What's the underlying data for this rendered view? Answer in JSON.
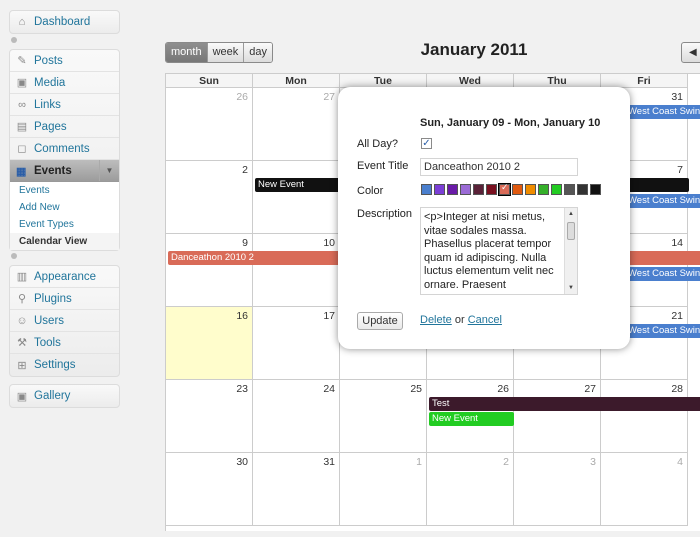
{
  "sidebar": {
    "dashboard": "Dashboard",
    "posts": "Posts",
    "media": "Media",
    "links": "Links",
    "pages": "Pages",
    "comments": "Comments",
    "events": "Events",
    "events_submenu": [
      "Events",
      "Add New",
      "Event Types",
      "Calendar View"
    ],
    "appearance": "Appearance",
    "plugins": "Plugins",
    "users": "Users",
    "tools": "Tools",
    "settings": "Settings",
    "gallery": "Gallery"
  },
  "toolbar": {
    "month": "month",
    "week": "week",
    "day": "day",
    "active": "month",
    "prev_arrow": "◀"
  },
  "calendar": {
    "title": "January 2011",
    "days_of_week": [
      "Sun",
      "Mon",
      "Tue",
      "Wed",
      "Thu",
      "Fri"
    ],
    "weeks": [
      [
        "26",
        "27",
        "",
        "",
        "",
        "31"
      ],
      [
        "2",
        "",
        "",
        "",
        "",
        "7"
      ],
      [
        "9",
        "10",
        "",
        "",
        "",
        "14"
      ],
      [
        "16",
        "17",
        "",
        "",
        "",
        "21"
      ],
      [
        "23",
        "24",
        "25",
        "26",
        "27",
        "28"
      ],
      [
        "30",
        "31",
        "1",
        "2",
        "3",
        "4"
      ]
    ],
    "events": {
      "new_event_1": "New Event",
      "danceathon": "Danceathon 2010 2",
      "west_coast_1": "West Coast Swin",
      "west_coast_2": "West Coast Swin",
      "west_coast_3": "West Coast Swin",
      "west_coast_4": "West Coast Swin",
      "test": "Test",
      "new_event_2": "New Event"
    },
    "colors": {
      "new_event_1": "#111111",
      "danceathon": "#d96b58",
      "west_coast": "#4a7fce",
      "test": "#3c1a2b",
      "new_event_2": "#22cc22",
      "today": "#fffdcc"
    }
  },
  "popup": {
    "date_range": "Sun, January 09 - Mon, January 10",
    "all_day_label": "All Day?",
    "all_day_checked": true,
    "event_title_label": "Event Title",
    "event_title_value": "Danceathon 2010 2",
    "color_label": "Color",
    "colors": [
      "#4a7fce",
      "#7b3fd6",
      "#6a1ba8",
      "#9b6bd6",
      "#5a2238",
      "#7a1020",
      "#d96b58",
      "#e05a10",
      "#f08c00",
      "#35b02a",
      "#22cc22",
      "#555555",
      "#333333",
      "#111111"
    ],
    "selected_color": "#d96b58",
    "description_label": "Description",
    "description": "<p>Integer at nisi metus, vitae sodales massa. Phasellus placerat tempor quam id adipiscing. Nulla luctus elementum velit nec ornare. Praesent",
    "update_button": "Update",
    "delete_link": "Delete",
    "or_text": "or",
    "cancel_link": "Cancel"
  }
}
